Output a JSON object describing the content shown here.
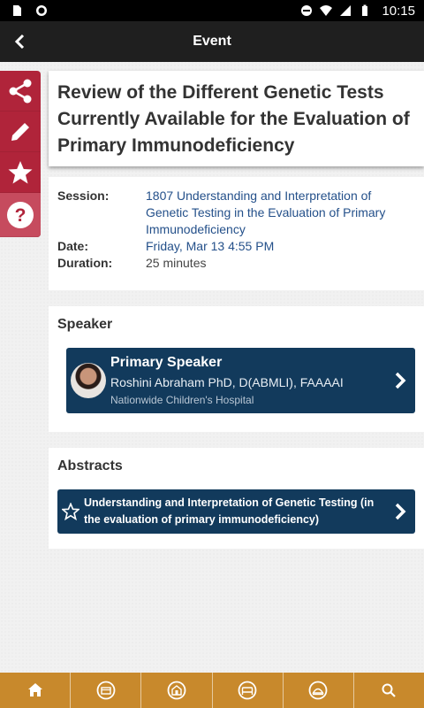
{
  "status_bar": {
    "time": "10:15"
  },
  "app_bar": {
    "title": "Event"
  },
  "event": {
    "title": "Review of the Different Genetic Tests Currently Available for the Evaluation of Primary Immunodeficiency",
    "details": {
      "session_label": "Session:",
      "session_value": "1807 Understanding and Interpretation of Genetic Testing in the Evaluation of Primary Immunodeficiency",
      "date_label": "Date:",
      "date_value": "Friday, Mar 13 4:55 PM",
      "duration_label": "Duration:",
      "duration_value": "25 minutes"
    }
  },
  "speaker_section": {
    "title": "Speaker",
    "role": "Primary Speaker",
    "name": "Roshini Abraham PhD, D(ABMLI), FAAAAI",
    "organization": "Nationwide Children's Hospital"
  },
  "abstracts_section": {
    "title": "Abstracts",
    "item": "Understanding and Interpretation of Genetic Testing (in the evaluation of primary immunodeficiency)"
  },
  "rail": [
    "share-icon",
    "pencil-icon",
    "star-icon",
    "help-icon"
  ],
  "bottom_nav": [
    "home-icon",
    "schedule-icon",
    "exhibit-hall-icon",
    "bed-icon",
    "food-icon",
    "search-icon"
  ],
  "colors": {
    "accent_red": "#b0243a",
    "navy": "#123a5c",
    "nav_orange": "#c8892c",
    "link_blue": "#24508a"
  }
}
